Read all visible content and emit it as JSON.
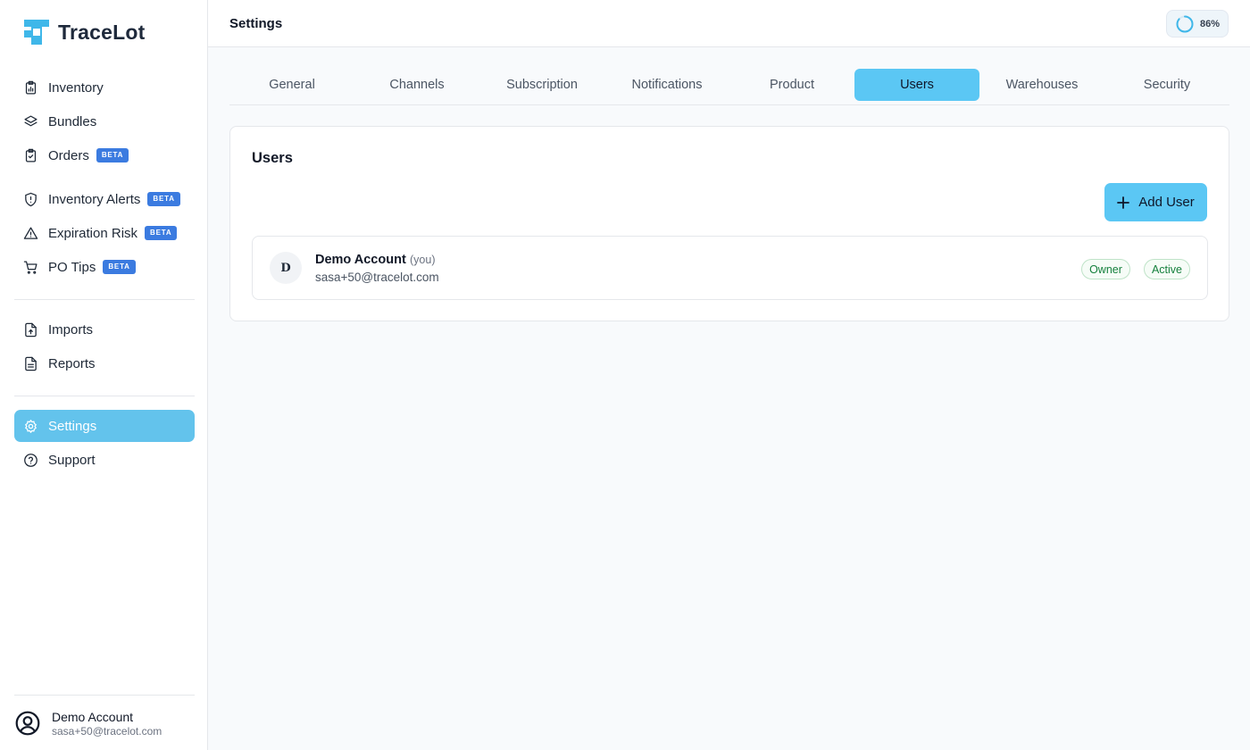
{
  "app": {
    "name": "TraceLot",
    "brand_color": "#3fb7e9"
  },
  "sidebar": {
    "main_items": [
      {
        "label": "Inventory",
        "icon": "clipboard-chart-icon",
        "beta": false
      },
      {
        "label": "Bundles",
        "icon": "layers-icon",
        "beta": false
      },
      {
        "label": "Orders",
        "icon": "clipboard-check-icon",
        "beta": true
      }
    ],
    "insight_items": [
      {
        "label": "Inventory Alerts",
        "icon": "shield-alert-icon",
        "beta": true
      },
      {
        "label": "Expiration Risk",
        "icon": "warning-triangle-icon",
        "beta": true
      },
      {
        "label": "PO Tips",
        "icon": "cart-icon",
        "beta": true
      }
    ],
    "data_items": [
      {
        "label": "Imports",
        "icon": "file-upload-icon"
      },
      {
        "label": "Reports",
        "icon": "file-text-icon"
      }
    ],
    "bottom_items": [
      {
        "label": "Settings",
        "icon": "gear-icon",
        "active": true
      },
      {
        "label": "Support",
        "icon": "help-circle-icon",
        "active": false
      }
    ],
    "beta_label": "BETA",
    "profile": {
      "name": "Demo Account",
      "email": "sasa+50@tracelot.com"
    }
  },
  "header": {
    "title": "Settings",
    "progress": {
      "value": 86,
      "label": "86%"
    }
  },
  "tabs": [
    {
      "label": "General",
      "active": false
    },
    {
      "label": "Channels",
      "active": false
    },
    {
      "label": "Subscription",
      "active": false
    },
    {
      "label": "Notifications",
      "active": false
    },
    {
      "label": "Product",
      "active": false
    },
    {
      "label": "Users",
      "active": true
    },
    {
      "label": "Warehouses",
      "active": false
    },
    {
      "label": "Security",
      "active": false
    }
  ],
  "users_panel": {
    "title": "Users",
    "add_button_label": "Add User",
    "users": [
      {
        "initial": "D",
        "name": "Demo Account",
        "you_label": "(you)",
        "email": "sasa+50@tracelot.com",
        "role": "Owner",
        "status": "Active"
      }
    ]
  }
}
